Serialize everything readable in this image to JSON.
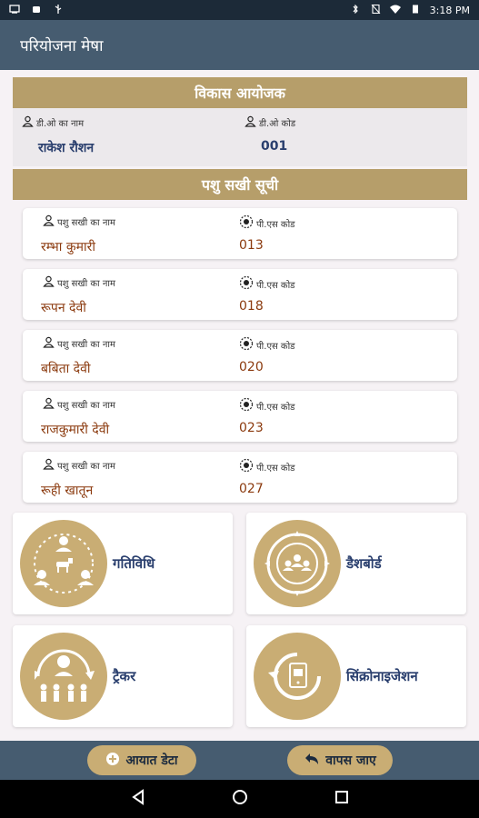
{
  "status_bar": {
    "time": "3:18 PM"
  },
  "app_bar": {
    "title": "परियोजना मेषा"
  },
  "officer_section": {
    "title": "विकास आयोजक",
    "name_label": "डी.ओ का नाम",
    "code_label": "डी.ओ कोड",
    "name": "राकेश रौशन",
    "code": "001"
  },
  "sakhi_section": {
    "title": "पशु सखी सूची",
    "name_label": "पशु सखी का नाम",
    "code_label": "पी.एस कोड",
    "items": [
      {
        "name": "रम्भा कुमारी",
        "code": "013"
      },
      {
        "name": "रूपन देवी",
        "code": "018"
      },
      {
        "name": "बबिता देवी",
        "code": "020"
      },
      {
        "name": "राजकुमारी देवी",
        "code": "023"
      },
      {
        "name": "रूही खातून",
        "code": "027"
      }
    ]
  },
  "tiles": [
    {
      "label": "गतिविधि",
      "icon": "activity-icon"
    },
    {
      "label": "डैशबोर्ड",
      "icon": "dashboard-icon"
    },
    {
      "label": "ट्रैकर",
      "icon": "tracker-icon"
    },
    {
      "label": "सिंक्रोनाइजेशन",
      "icon": "sync-icon"
    }
  ],
  "bottom_bar": {
    "import_label": "आयात डेटा",
    "back_label": "वापस जाए"
  },
  "colors": {
    "app_bar": "#465c70",
    "section_header": "#b69e6a",
    "tile_circle": "#c9ad74",
    "value_blue": "#2a3f6e",
    "value_brown": "#8b3a0e"
  }
}
